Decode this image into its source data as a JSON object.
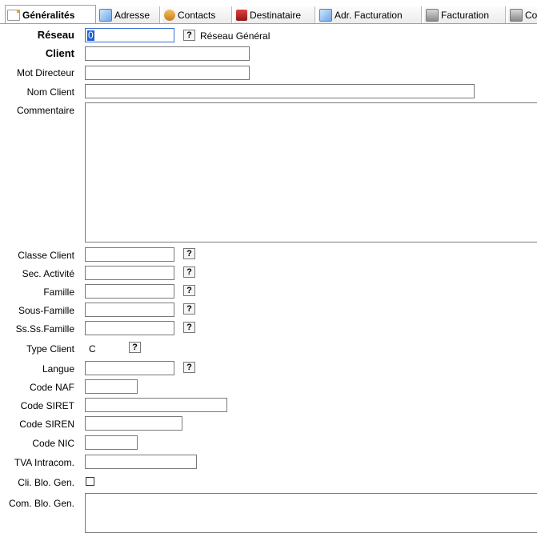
{
  "tabs": [
    {
      "label": "Généralités",
      "icon": "document-icon",
      "active": true
    },
    {
      "label": "Adresse",
      "icon": "envelope-icon"
    },
    {
      "label": "Contacts",
      "icon": "people-icon"
    },
    {
      "label": "Destinataire",
      "icon": "book-icon"
    },
    {
      "label": "Adr. Facturation",
      "icon": "envelope-icon"
    },
    {
      "label": "Facturation",
      "icon": "calculator-icon"
    },
    {
      "label": "Co",
      "icon": "calculator-icon"
    }
  ],
  "form": {
    "reseau": {
      "label": "Réseau",
      "value": "0",
      "lookup": "?",
      "description": "Réseau Général"
    },
    "client": {
      "label": "Client",
      "value": ""
    },
    "mot_directeur": {
      "label": "Mot Directeur",
      "value": ""
    },
    "nom_client": {
      "label": "Nom Client",
      "value": ""
    },
    "commentaire": {
      "label": "Commentaire",
      "value": ""
    },
    "classe_client": {
      "label": "Classe Client",
      "value": "",
      "lookup": "?"
    },
    "sec_activite": {
      "label": "Sec. Activité",
      "value": "",
      "lookup": "?"
    },
    "famille": {
      "label": "Famille",
      "value": "",
      "lookup": "?"
    },
    "sous_famille": {
      "label": "Sous-Famille",
      "value": "",
      "lookup": "?"
    },
    "ss_ss_famille": {
      "label": "Ss.Ss.Famille",
      "value": "",
      "lookup": "?"
    },
    "type_client": {
      "label": "Type Client",
      "value": "C",
      "lookup": "?"
    },
    "langue": {
      "label": "Langue",
      "value": "",
      "lookup": "?"
    },
    "code_naf": {
      "label": "Code NAF",
      "value": ""
    },
    "code_siret": {
      "label": "Code SIRET",
      "value": ""
    },
    "code_siren": {
      "label": "Code SIREN",
      "value": ""
    },
    "code_nic": {
      "label": "Code NIC",
      "value": ""
    },
    "tva_intracom": {
      "label": "TVA Intracom.",
      "value": ""
    },
    "cli_blo_gen": {
      "label": "Cli. Blo. Gen.",
      "checked": false
    },
    "com_blo_gen": {
      "label": "Com. Blo. Gen.",
      "value": ""
    }
  }
}
